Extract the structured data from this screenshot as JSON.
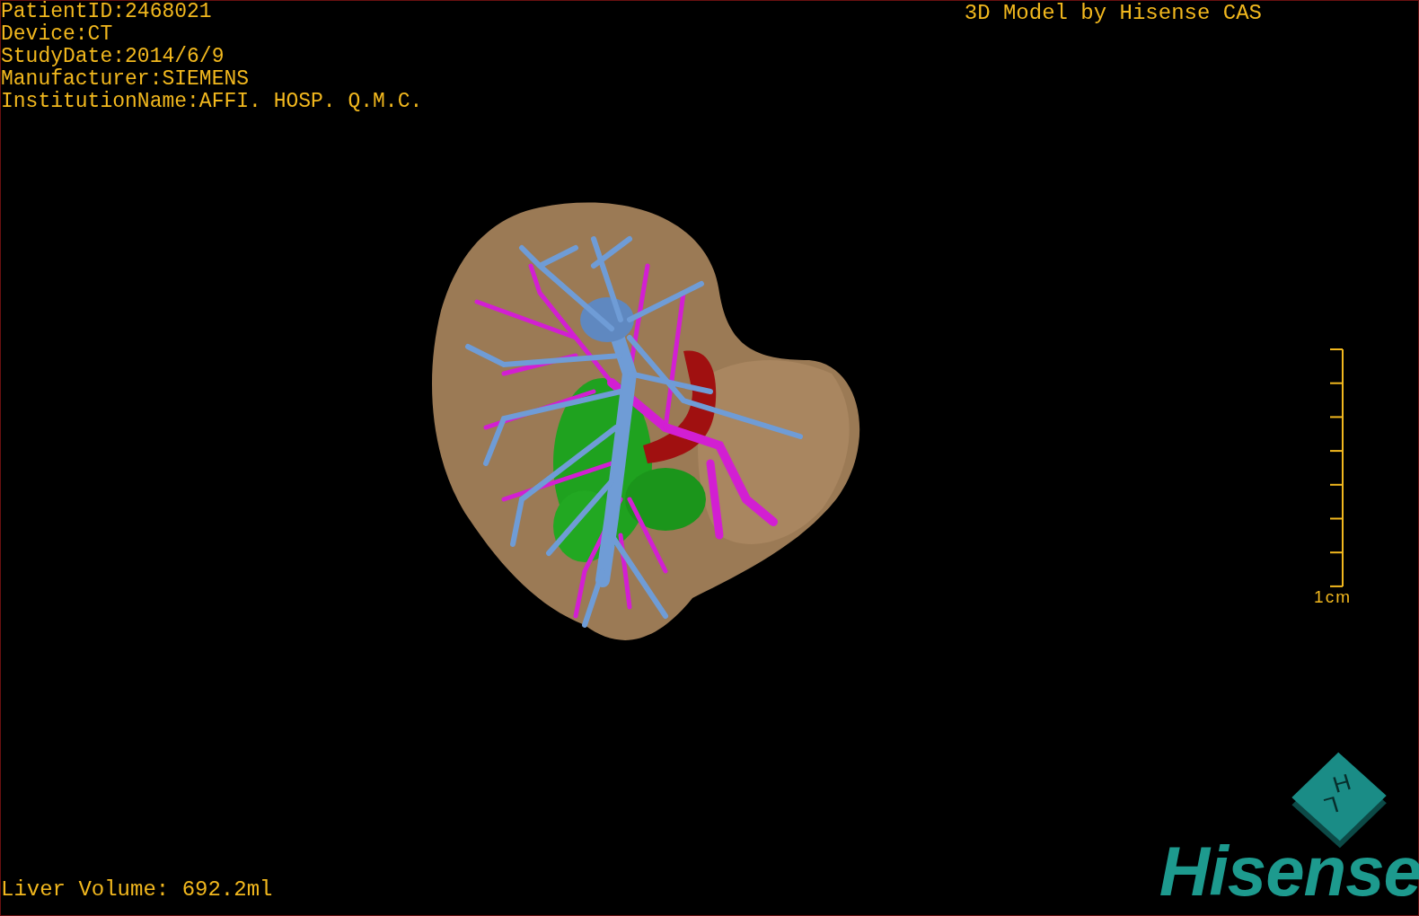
{
  "overlay_info": [
    "PatientID:2468021",
    "Device:CT",
    "StudyDate:2014/6/9",
    "Manufacturer:SIEMENS",
    "InstitutionName:AFFI. HOSP. Q.M.C."
  ],
  "title": "3D Model by Hisense CAS",
  "scale_bar": {
    "label": "1cm"
  },
  "liver_volume": "Liver Volume: 692.2ml",
  "logo": {
    "cube_labels": [
      "H",
      "L"
    ],
    "wordmark": "Hisense"
  }
}
